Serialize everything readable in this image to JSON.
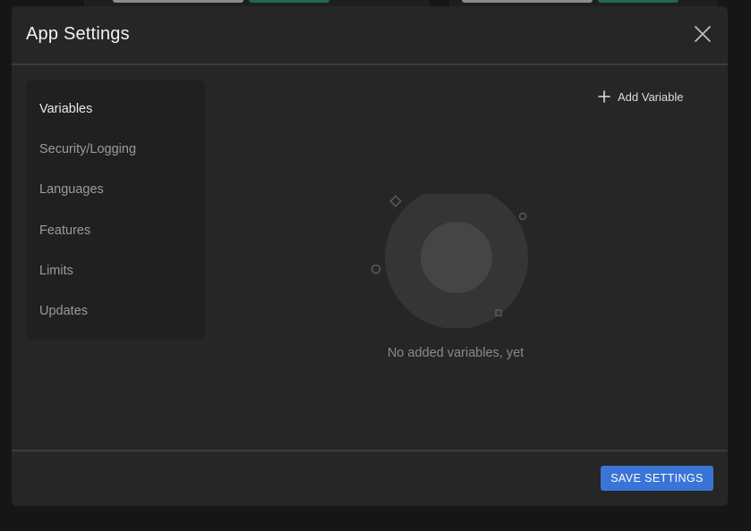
{
  "modal": {
    "title": "App Settings"
  },
  "sidebar": {
    "items": [
      {
        "label": "Variables",
        "active": true
      },
      {
        "label": "Security/Logging",
        "active": false
      },
      {
        "label": "Languages",
        "active": false
      },
      {
        "label": "Features",
        "active": false
      },
      {
        "label": "Limits",
        "active": false
      },
      {
        "label": "Updates",
        "active": false
      }
    ]
  },
  "main": {
    "add_variable_label": "Add Variable",
    "empty_state_text": "No added variables, yet"
  },
  "footer": {
    "save_label": "SAVE SETTINGS"
  },
  "colors": {
    "accent": "#3a74d6",
    "modal_background": "#262626",
    "sidebar_background": "#202020"
  },
  "icons": [
    "close-icon",
    "plus-icon",
    "empty-state-illustration"
  ]
}
